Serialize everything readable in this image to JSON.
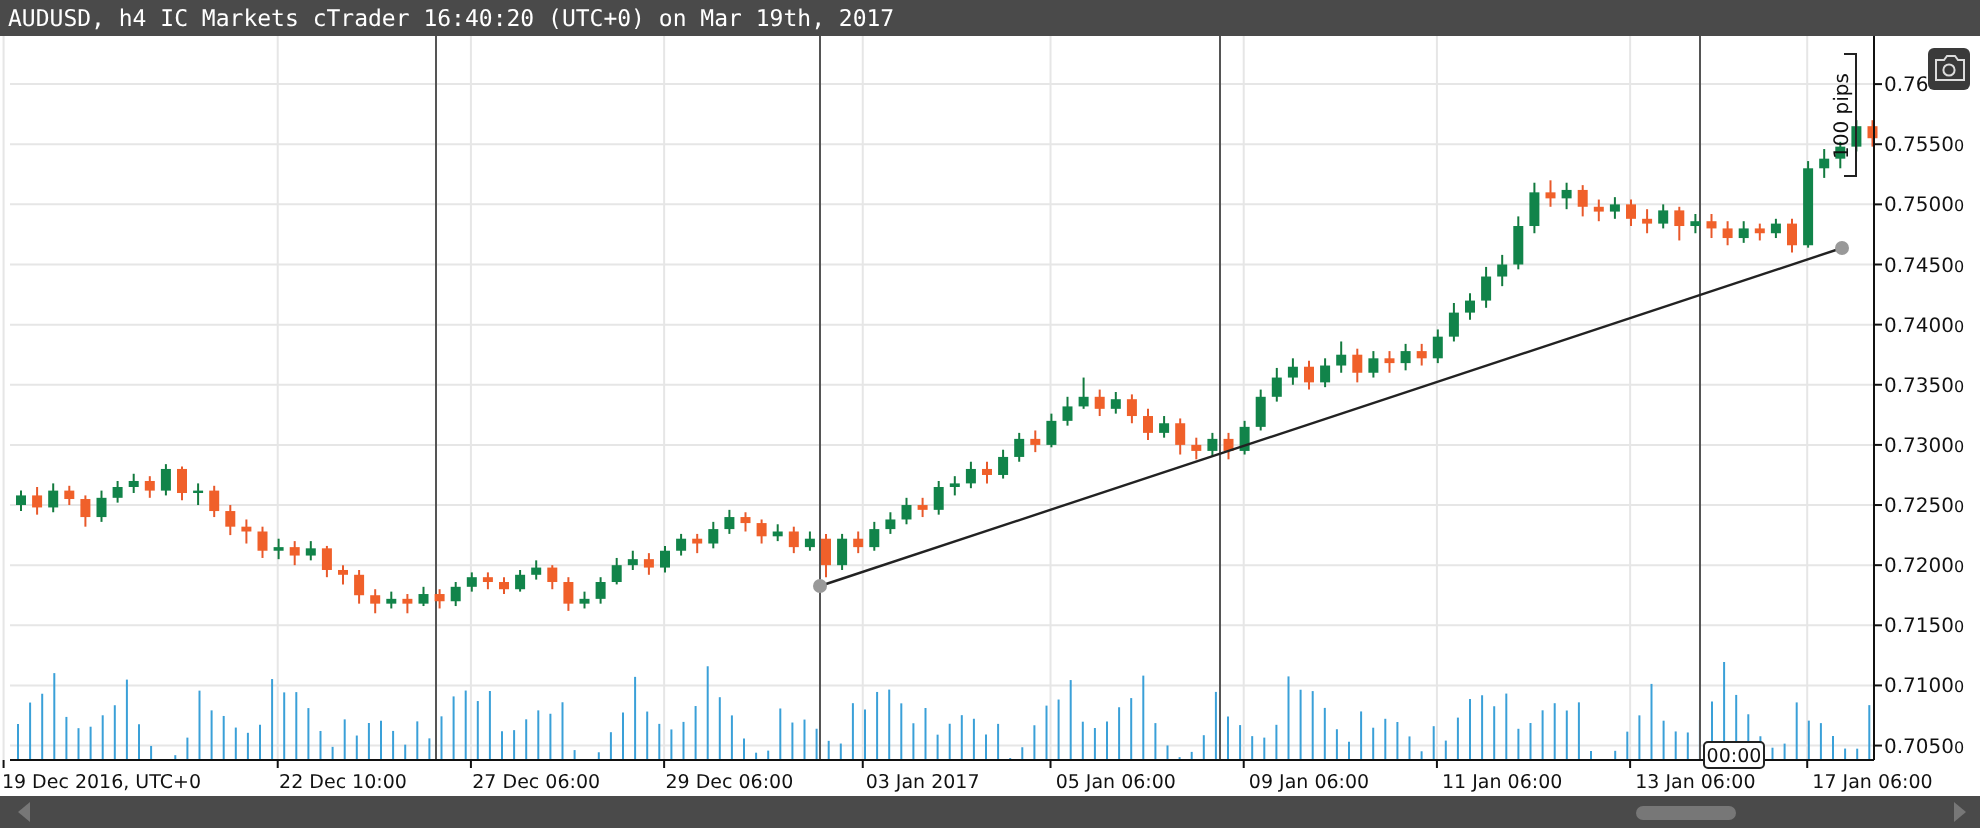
{
  "title": "AUDUSD, h4 IC Markets cTrader 16:40:20 (UTC+0) on Mar 19th, 2017",
  "chart_data": {
    "type": "candlestick",
    "categories": [
      null,
      null,
      null,
      null,
      null,
      "19 Dec 2016, UTC+0",
      null,
      null,
      null,
      null,
      null,
      null,
      null,
      null,
      null,
      null,
      null,
      null,
      null,
      null,
      "22 Dec 10:00",
      null,
      null,
      null,
      null,
      null,
      null,
      null,
      null,
      null,
      null,
      null,
      "27 Dec 06:00",
      null,
      null,
      null,
      null,
      null,
      null,
      null,
      null,
      null,
      null,
      null,
      "29 Dec 06:00",
      null,
      null,
      null,
      null,
      null,
      null,
      null,
      null,
      null,
      null,
      null,
      "03 Jan 2017",
      null,
      null,
      null,
      null,
      null,
      null,
      null,
      null,
      null,
      null,
      null,
      "05 Jan 06:00",
      null,
      null,
      null,
      null,
      null,
      null,
      null,
      null,
      null,
      null,
      null,
      "09 Jan 06:00",
      null,
      null,
      null,
      null,
      null,
      null,
      null,
      null,
      null,
      null,
      null,
      "11 Jan 06:00",
      null,
      null,
      null,
      null,
      null,
      null,
      null,
      null,
      null,
      null,
      null,
      "13 Jan 06:00",
      null,
      null,
      null,
      null,
      null,
      null,
      null,
      null,
      null,
      null,
      "17 Jan 06:00"
    ],
    "grid": true,
    "ylim": [
      0.7038,
      0.764
    ],
    "ohlc": [
      [
        0.725,
        0.7262,
        0.7245,
        0.7258
      ],
      [
        0.7258,
        0.7265,
        0.7242,
        0.7248
      ],
      [
        0.7248,
        0.7268,
        0.7244,
        0.7262
      ],
      [
        0.7262,
        0.7266,
        0.725,
        0.7255
      ],
      [
        0.7255,
        0.7258,
        0.7232,
        0.724
      ],
      [
        0.724,
        0.7262,
        0.7236,
        0.7256
      ],
      [
        0.7256,
        0.727,
        0.7252,
        0.7265
      ],
      [
        0.7265,
        0.7276,
        0.726,
        0.727
      ],
      [
        0.727,
        0.7274,
        0.7256,
        0.7262
      ],
      [
        0.7262,
        0.7284,
        0.7258,
        0.728
      ],
      [
        0.728,
        0.7282,
        0.7254,
        0.726
      ],
      [
        0.726,
        0.7268,
        0.725,
        0.7262
      ],
      [
        0.7262,
        0.7266,
        0.724,
        0.7245
      ],
      [
        0.7245,
        0.725,
        0.7225,
        0.7232
      ],
      [
        0.7232,
        0.7238,
        0.7218,
        0.7228
      ],
      [
        0.7228,
        0.7232,
        0.7206,
        0.7212
      ],
      [
        0.7212,
        0.7222,
        0.7205,
        0.7215
      ],
      [
        0.7215,
        0.722,
        0.72,
        0.7208
      ],
      [
        0.7208,
        0.722,
        0.7204,
        0.7214
      ],
      [
        0.7214,
        0.7216,
        0.719,
        0.7196
      ],
      [
        0.7196,
        0.72,
        0.7184,
        0.7192
      ],
      [
        0.7192,
        0.7196,
        0.7168,
        0.7175
      ],
      [
        0.7175,
        0.718,
        0.716,
        0.7168
      ],
      [
        0.7168,
        0.7178,
        0.7164,
        0.7172
      ],
      [
        0.7172,
        0.7176,
        0.716,
        0.7168
      ],
      [
        0.7168,
        0.7182,
        0.7166,
        0.7176
      ],
      [
        0.7176,
        0.718,
        0.7164,
        0.717
      ],
      [
        0.717,
        0.7186,
        0.7166,
        0.7182
      ],
      [
        0.7182,
        0.7194,
        0.7178,
        0.719
      ],
      [
        0.719,
        0.7194,
        0.718,
        0.7186
      ],
      [
        0.7186,
        0.719,
        0.7176,
        0.718
      ],
      [
        0.718,
        0.7196,
        0.7178,
        0.7192
      ],
      [
        0.7192,
        0.7204,
        0.7188,
        0.7198
      ],
      [
        0.7198,
        0.72,
        0.718,
        0.7186
      ],
      [
        0.7186,
        0.719,
        0.7162,
        0.7168
      ],
      [
        0.7168,
        0.7178,
        0.7164,
        0.7172
      ],
      [
        0.7172,
        0.719,
        0.7168,
        0.7186
      ],
      [
        0.7186,
        0.7206,
        0.7184,
        0.72
      ],
      [
        0.72,
        0.7212,
        0.7196,
        0.7205
      ],
      [
        0.7205,
        0.721,
        0.7192,
        0.7198
      ],
      [
        0.7198,
        0.7216,
        0.7194,
        0.7212
      ],
      [
        0.7212,
        0.7226,
        0.7208,
        0.7222
      ],
      [
        0.7222,
        0.7226,
        0.721,
        0.7218
      ],
      [
        0.7218,
        0.7236,
        0.7214,
        0.723
      ],
      [
        0.723,
        0.7246,
        0.7226,
        0.724
      ],
      [
        0.724,
        0.7244,
        0.7228,
        0.7235
      ],
      [
        0.7235,
        0.7238,
        0.7218,
        0.7224
      ],
      [
        0.7224,
        0.7234,
        0.722,
        0.7228
      ],
      [
        0.7228,
        0.7232,
        0.721,
        0.7215
      ],
      [
        0.7215,
        0.7228,
        0.7212,
        0.7222
      ],
      [
        0.7222,
        0.7226,
        0.719,
        0.72
      ],
      [
        0.72,
        0.7226,
        0.7196,
        0.7222
      ],
      [
        0.7222,
        0.7228,
        0.721,
        0.7215
      ],
      [
        0.7215,
        0.7236,
        0.7212,
        0.723
      ],
      [
        0.723,
        0.7244,
        0.7226,
        0.7238
      ],
      [
        0.7238,
        0.7256,
        0.7234,
        0.725
      ],
      [
        0.725,
        0.7256,
        0.724,
        0.7246
      ],
      [
        0.7246,
        0.727,
        0.7242,
        0.7265
      ],
      [
        0.7265,
        0.7274,
        0.7258,
        0.7268
      ],
      [
        0.7268,
        0.7286,
        0.7264,
        0.728
      ],
      [
        0.728,
        0.7286,
        0.7268,
        0.7275
      ],
      [
        0.7275,
        0.7296,
        0.7272,
        0.729
      ],
      [
        0.729,
        0.731,
        0.7286,
        0.7305
      ],
      [
        0.7305,
        0.7312,
        0.7294,
        0.73
      ],
      [
        0.73,
        0.7326,
        0.7298,
        0.732
      ],
      [
        0.732,
        0.734,
        0.7316,
        0.7332
      ],
      [
        0.7332,
        0.7356,
        0.733,
        0.734
      ],
      [
        0.734,
        0.7346,
        0.7324,
        0.733
      ],
      [
        0.733,
        0.7344,
        0.7326,
        0.7338
      ],
      [
        0.7338,
        0.7342,
        0.7318,
        0.7324
      ],
      [
        0.7324,
        0.733,
        0.7304,
        0.731
      ],
      [
        0.731,
        0.7324,
        0.7306,
        0.7318
      ],
      [
        0.7318,
        0.7322,
        0.7292,
        0.73
      ],
      [
        0.73,
        0.7306,
        0.7288,
        0.7295
      ],
      [
        0.7295,
        0.731,
        0.729,
        0.7305
      ],
      [
        0.7305,
        0.731,
        0.7288,
        0.7295
      ],
      [
        0.7295,
        0.732,
        0.7292,
        0.7315
      ],
      [
        0.7315,
        0.7346,
        0.7312,
        0.734
      ],
      [
        0.734,
        0.7364,
        0.7336,
        0.7356
      ],
      [
        0.7356,
        0.7372,
        0.735,
        0.7365
      ],
      [
        0.7365,
        0.737,
        0.7346,
        0.7352
      ],
      [
        0.7352,
        0.7372,
        0.7348,
        0.7366
      ],
      [
        0.7366,
        0.7386,
        0.736,
        0.7375
      ],
      [
        0.7375,
        0.738,
        0.7352,
        0.736
      ],
      [
        0.736,
        0.7378,
        0.7356,
        0.7372
      ],
      [
        0.7372,
        0.7378,
        0.736,
        0.7368
      ],
      [
        0.7368,
        0.7384,
        0.7362,
        0.7378
      ],
      [
        0.7378,
        0.7384,
        0.7366,
        0.7372
      ],
      [
        0.7372,
        0.7396,
        0.7368,
        0.739
      ],
      [
        0.739,
        0.7418,
        0.7386,
        0.741
      ],
      [
        0.741,
        0.7426,
        0.7404,
        0.742
      ],
      [
        0.742,
        0.7448,
        0.7414,
        0.744
      ],
      [
        0.744,
        0.7458,
        0.7432,
        0.745
      ],
      [
        0.745,
        0.749,
        0.7446,
        0.7482
      ],
      [
        0.7482,
        0.7518,
        0.7476,
        0.751
      ],
      [
        0.751,
        0.752,
        0.7498,
        0.7505
      ],
      [
        0.7505,
        0.7518,
        0.7496,
        0.7512
      ],
      [
        0.7512,
        0.7516,
        0.749,
        0.7498
      ],
      [
        0.7498,
        0.7504,
        0.7486,
        0.7494
      ],
      [
        0.7494,
        0.7506,
        0.7488,
        0.75
      ],
      [
        0.75,
        0.7504,
        0.7482,
        0.7488
      ],
      [
        0.7488,
        0.7496,
        0.7476,
        0.7484
      ],
      [
        0.7484,
        0.75,
        0.748,
        0.7495
      ],
      [
        0.7495,
        0.7498,
        0.747,
        0.7482
      ],
      [
        0.7482,
        0.7492,
        0.7476,
        0.7486
      ],
      [
        0.7486,
        0.7492,
        0.7472,
        0.748
      ],
      [
        0.748,
        0.7486,
        0.7466,
        0.7472
      ],
      [
        0.7472,
        0.7486,
        0.7468,
        0.748
      ],
      [
        0.748,
        0.7484,
        0.747,
        0.7476
      ],
      [
        0.7476,
        0.7488,
        0.7472,
        0.7484
      ],
      [
        0.7484,
        0.7488,
        0.746,
        0.7466
      ],
      [
        0.7466,
        0.7536,
        0.7464,
        0.753
      ],
      [
        0.753,
        0.7546,
        0.7522,
        0.7538
      ],
      [
        0.7538,
        0.7552,
        0.753,
        0.7548
      ],
      [
        0.7548,
        0.757,
        0.7544,
        0.7565
      ],
      [
        0.7565,
        0.757,
        0.7548,
        0.7555
      ]
    ],
    "yticks": [
      {
        "value": 0.76,
        "label": "0.76"
      },
      {
        "value": 0.755,
        "label": "0.75500"
      },
      {
        "value": 0.75,
        "label": "0.75000"
      },
      {
        "value": 0.745,
        "label": "0.74500"
      },
      {
        "value": 0.74,
        "label": "0.74000"
      },
      {
        "value": 0.735,
        "label": "0.73500"
      },
      {
        "value": 0.73,
        "label": "0.73000"
      },
      {
        "value": 0.725,
        "label": "0.72500"
      },
      {
        "value": 0.72,
        "label": "0.72000"
      },
      {
        "value": 0.715,
        "label": "0.71500"
      },
      {
        "value": 0.71,
        "label": "0.71000"
      },
      {
        "value": 0.705,
        "label": "0.70500"
      }
    ]
  },
  "ruler": {
    "label": "100 pips"
  },
  "cursor": {
    "label": "00:00"
  }
}
